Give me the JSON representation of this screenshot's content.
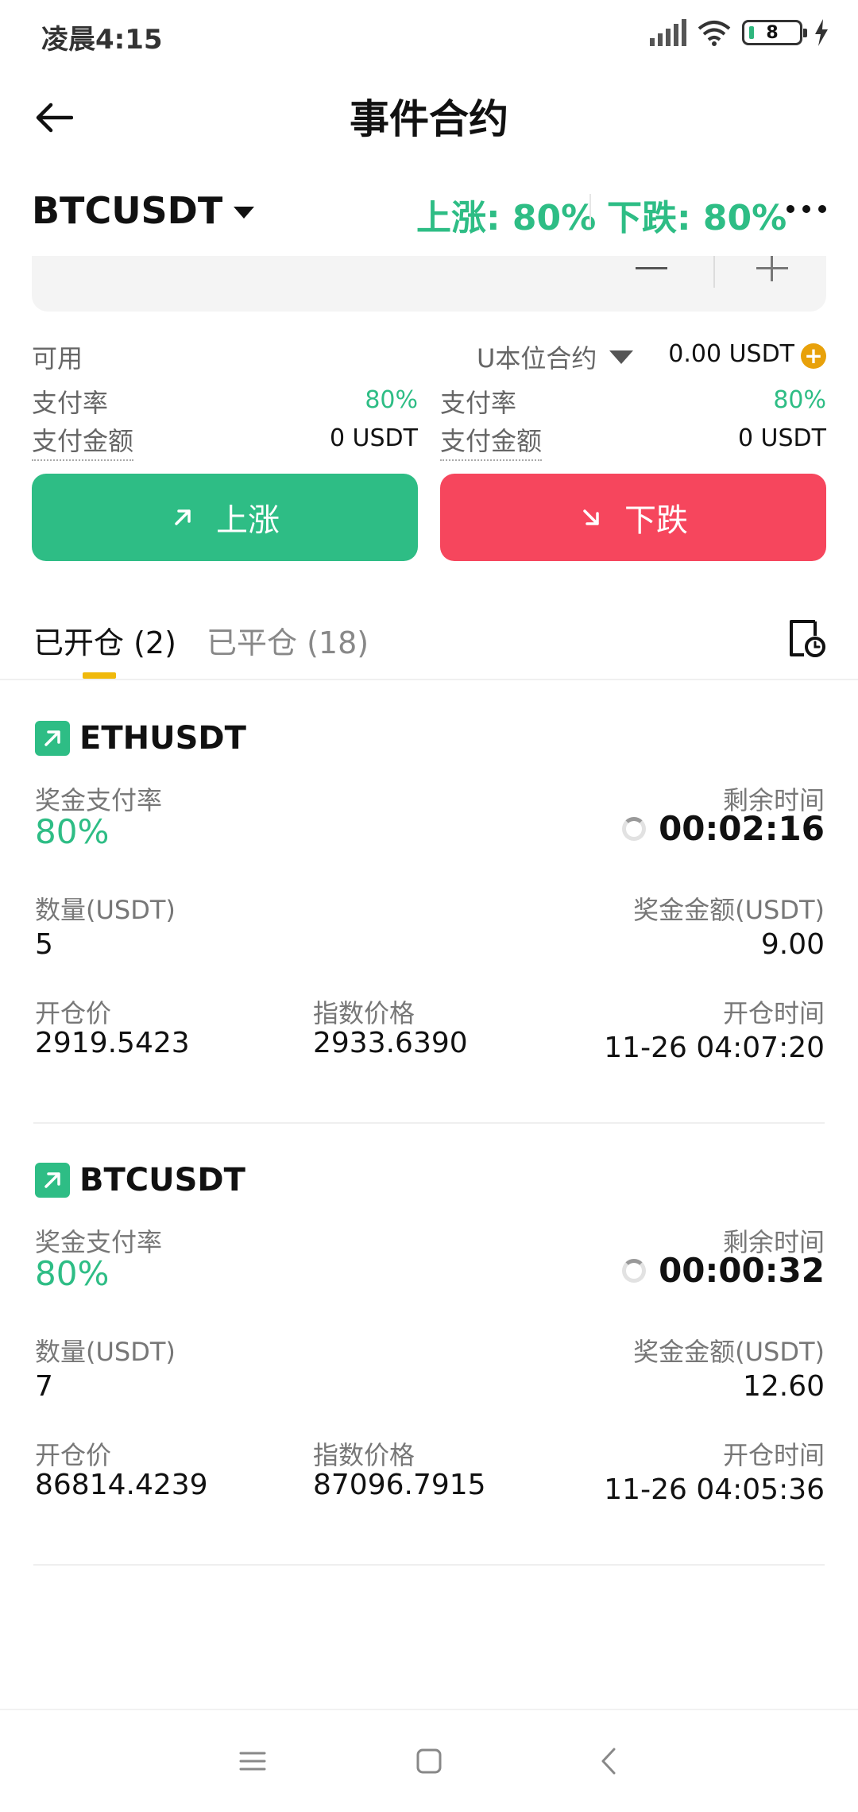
{
  "status_bar": {
    "time": "凌晨4:15",
    "battery": "8"
  },
  "header": {
    "title": "事件合约",
    "back_icon": "arrow-left-icon"
  },
  "market": {
    "symbol": "BTCUSDT",
    "rise_rate": "上涨: 80%",
    "fall_rate": "下跌: 80%"
  },
  "account": {
    "available_label": "可用",
    "contract_type": "U本位合约",
    "balance": "0.00 USDT"
  },
  "payout": {
    "left": {
      "rate_label": "支付率",
      "rate_value": "80%",
      "amount_label": "支付金额",
      "amount_value": "0 USDT"
    },
    "right": {
      "rate_label": "支付率",
      "rate_value": "80%",
      "amount_label": "支付金额",
      "amount_value": "0 USDT"
    }
  },
  "actions": {
    "rise_label": "上涨",
    "fall_label": "下跌"
  },
  "tabs": {
    "open": "已开仓 (2)",
    "closed": "已平仓 (18)"
  },
  "positions": [
    {
      "symbol": "ETHUSDT",
      "direction": "up",
      "payout_rate_label": "奖金支付率",
      "payout_rate": "80%",
      "remaining_label": "剩余时间",
      "remaining": "00:02:16",
      "qty_label": "数量(USDT)",
      "qty": "5",
      "reward_label": "奖金金额(USDT)",
      "reward": "9.00",
      "open_price_label": "开仓价",
      "open_price": "2919.5423",
      "index_price_label": "指数价格",
      "index_price": "2933.6390",
      "open_time_label": "开仓时间",
      "open_time": "11-26 04:07:20"
    },
    {
      "symbol": "BTCUSDT",
      "direction": "up",
      "payout_rate_label": "奖金支付率",
      "payout_rate": "80%",
      "remaining_label": "剩余时间",
      "remaining": "00:00:32",
      "qty_label": "数量(USDT)",
      "qty": "7",
      "reward_label": "奖金金额(USDT)",
      "reward": "12.60",
      "open_price_label": "开仓价",
      "open_price": "86814.4239",
      "index_price_label": "指数价格",
      "index_price": "87096.7915",
      "open_time_label": "开仓时间",
      "open_time": "11-26 04:05:36"
    }
  ],
  "colors": {
    "rise": "#2ebd85",
    "fall": "#f6465d",
    "tab_indicator": "#f0b90b",
    "add_funds": "#e8a10a"
  }
}
